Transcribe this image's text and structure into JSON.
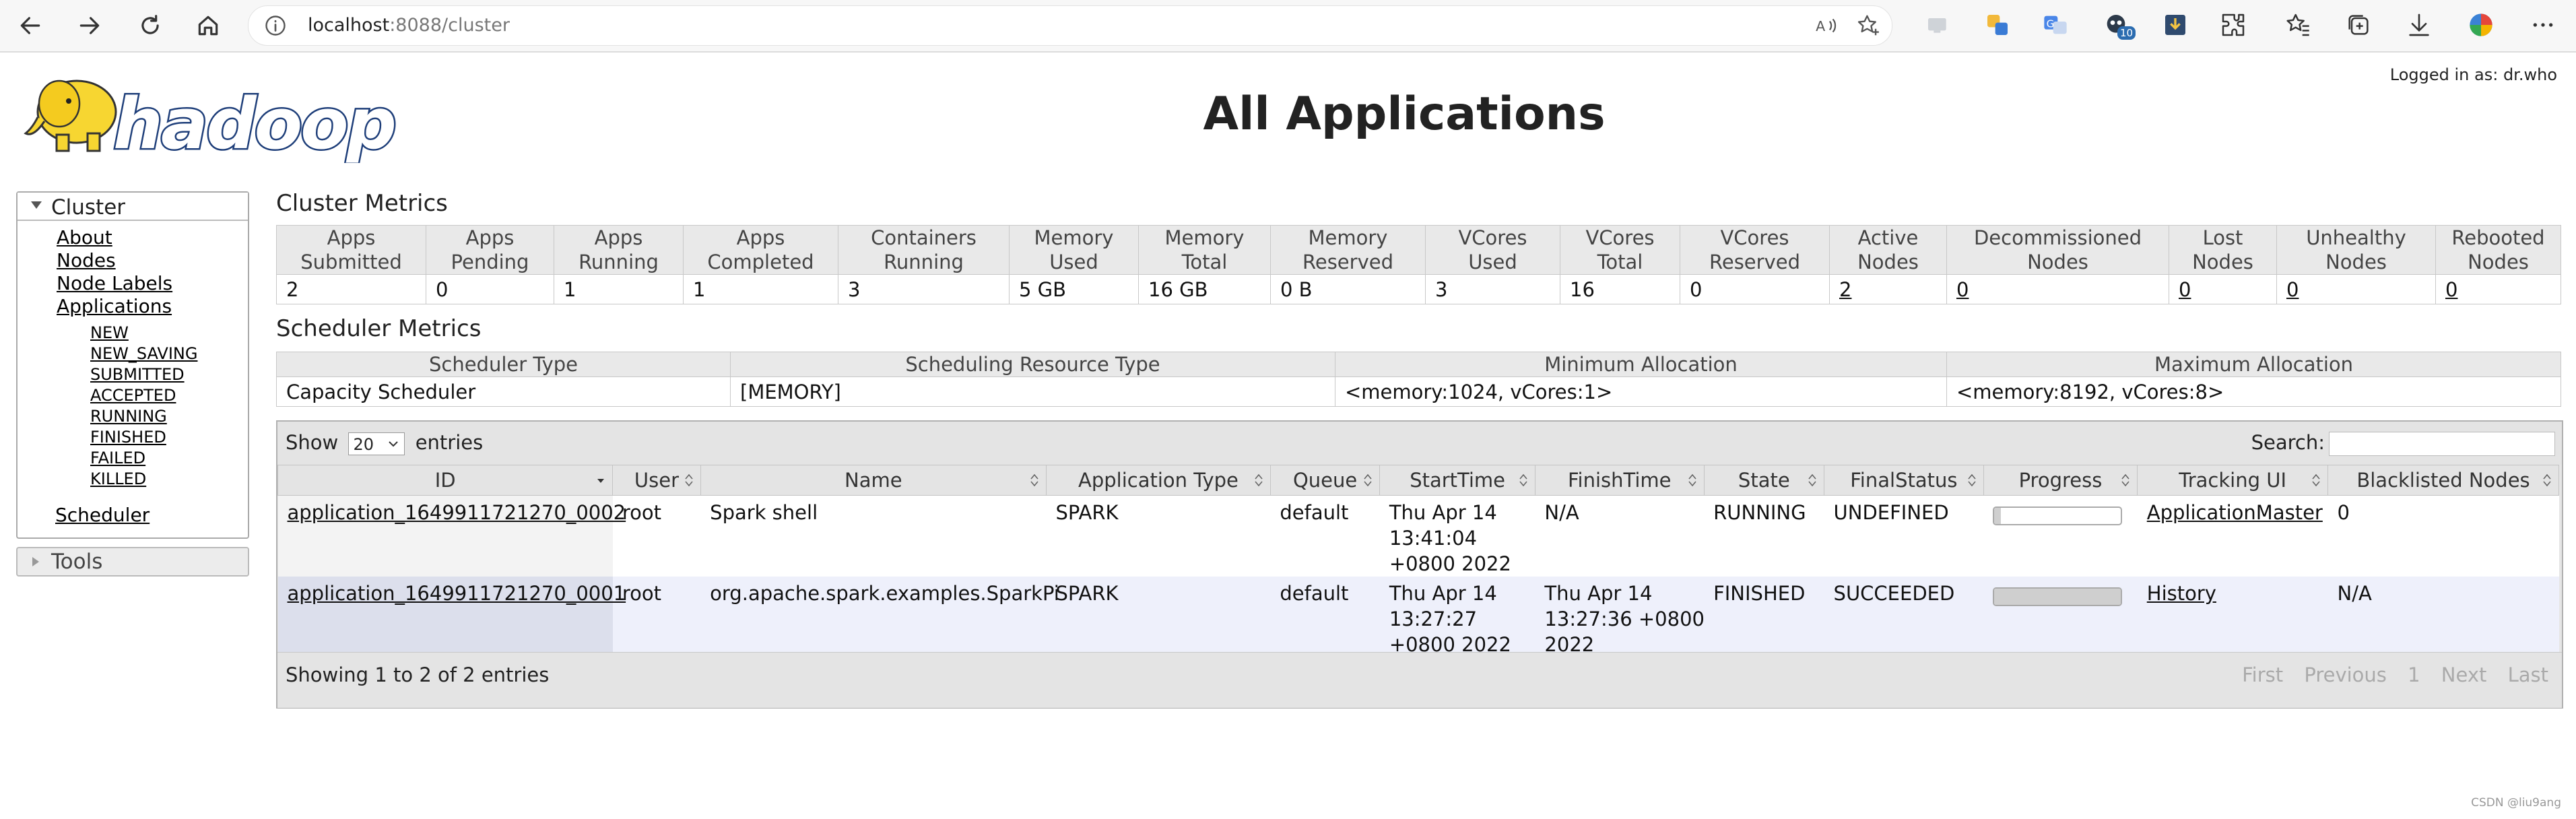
{
  "browser": {
    "url_host": "localhost",
    "url_rest": ":8088/cluster",
    "extension_badge": "10"
  },
  "header": {
    "logo_text": "hadoop",
    "logged_in": "Logged in as: dr.who",
    "title": "All Applications"
  },
  "sidebar": {
    "cluster_label": "Cluster",
    "links": [
      "About",
      "Nodes",
      "Node Labels",
      "Applications"
    ],
    "states": [
      "NEW",
      "NEW_SAVING",
      "SUBMITTED",
      "ACCEPTED",
      "RUNNING",
      "FINISHED",
      "FAILED",
      "KILLED"
    ],
    "scheduler": "Scheduler",
    "tools_label": "Tools"
  },
  "cluster_metrics": {
    "title": "Cluster Metrics",
    "headers": [
      [
        "Apps",
        "Submitted"
      ],
      [
        "Apps",
        "Pending"
      ],
      [
        "Apps",
        "Running"
      ],
      [
        "Apps",
        "Completed"
      ],
      [
        "Containers",
        "Running"
      ],
      [
        "Memory",
        "Used"
      ],
      [
        "Memory",
        "Total"
      ],
      [
        "Memory",
        "Reserved"
      ],
      [
        "VCores",
        "Used"
      ],
      [
        "VCores",
        "Total"
      ],
      [
        "VCores",
        "Reserved"
      ],
      [
        "Active",
        "Nodes"
      ],
      [
        "Decommissioned",
        "Nodes"
      ],
      [
        "Lost",
        "Nodes"
      ],
      [
        "Unhealthy",
        "Nodes"
      ],
      [
        "Rebooted",
        "Nodes"
      ]
    ],
    "values": [
      "2",
      "0",
      "1",
      "1",
      "3",
      "5 GB",
      "16 GB",
      "0 B",
      "3",
      "16",
      "0",
      "2",
      "0",
      "0",
      "0",
      "0"
    ]
  },
  "scheduler_metrics": {
    "title": "Scheduler Metrics",
    "headers": [
      "Scheduler Type",
      "Scheduling Resource Type",
      "Minimum Allocation",
      "Maximum Allocation"
    ],
    "values": [
      "Capacity Scheduler",
      "[MEMORY]",
      "<memory:1024, vCores:1>",
      "<memory:8192, vCores:8>"
    ]
  },
  "apps_table": {
    "show_label": "Show",
    "page_size": "20",
    "entries_label": "entries",
    "search_label": "Search:",
    "columns": [
      "ID",
      "User",
      "Name",
      "Application Type",
      "Queue",
      "StartTime",
      "FinishTime",
      "State",
      "FinalStatus",
      "Progress",
      "Tracking UI",
      "Blacklisted Nodes"
    ],
    "rows": [
      {
        "id": "application_1649911721270_0002",
        "user": "root",
        "name": "Spark shell",
        "type": "SPARK",
        "queue": "default",
        "start": [
          "Thu Apr 14",
          "13:41:04",
          "+0800 2022"
        ],
        "finish": [
          "N/A",
          "",
          ""
        ],
        "state": "RUNNING",
        "final_status": "UNDEFINED",
        "progress": 0.05,
        "tracking_ui": "ApplicationMaster",
        "blacklisted": "0"
      },
      {
        "id": "application_1649911721270_0001",
        "user": "root",
        "name": "org.apache.spark.examples.SparkPi",
        "type": "SPARK",
        "queue": "default",
        "start": [
          "Thu Apr 14",
          "13:27:27",
          "+0800 2022"
        ],
        "finish": [
          "Thu Apr 14",
          "13:27:36 +0800",
          "2022"
        ],
        "state": "FINISHED",
        "final_status": "SUCCEEDED",
        "progress": 1.0,
        "tracking_ui": "History",
        "blacklisted": "N/A"
      }
    ],
    "info": "Showing 1 to 2 of 2 entries",
    "pager": [
      "First",
      "Previous",
      "1",
      "Next",
      "Last"
    ]
  },
  "watermark": "CSDN @liu9ang",
  "colors": {
    "logo_yellow": "#f7d631",
    "logo_blue": "#2a4d8f",
    "header_gray": "#e9e9e9",
    "row_alt": "#eef0fb"
  }
}
